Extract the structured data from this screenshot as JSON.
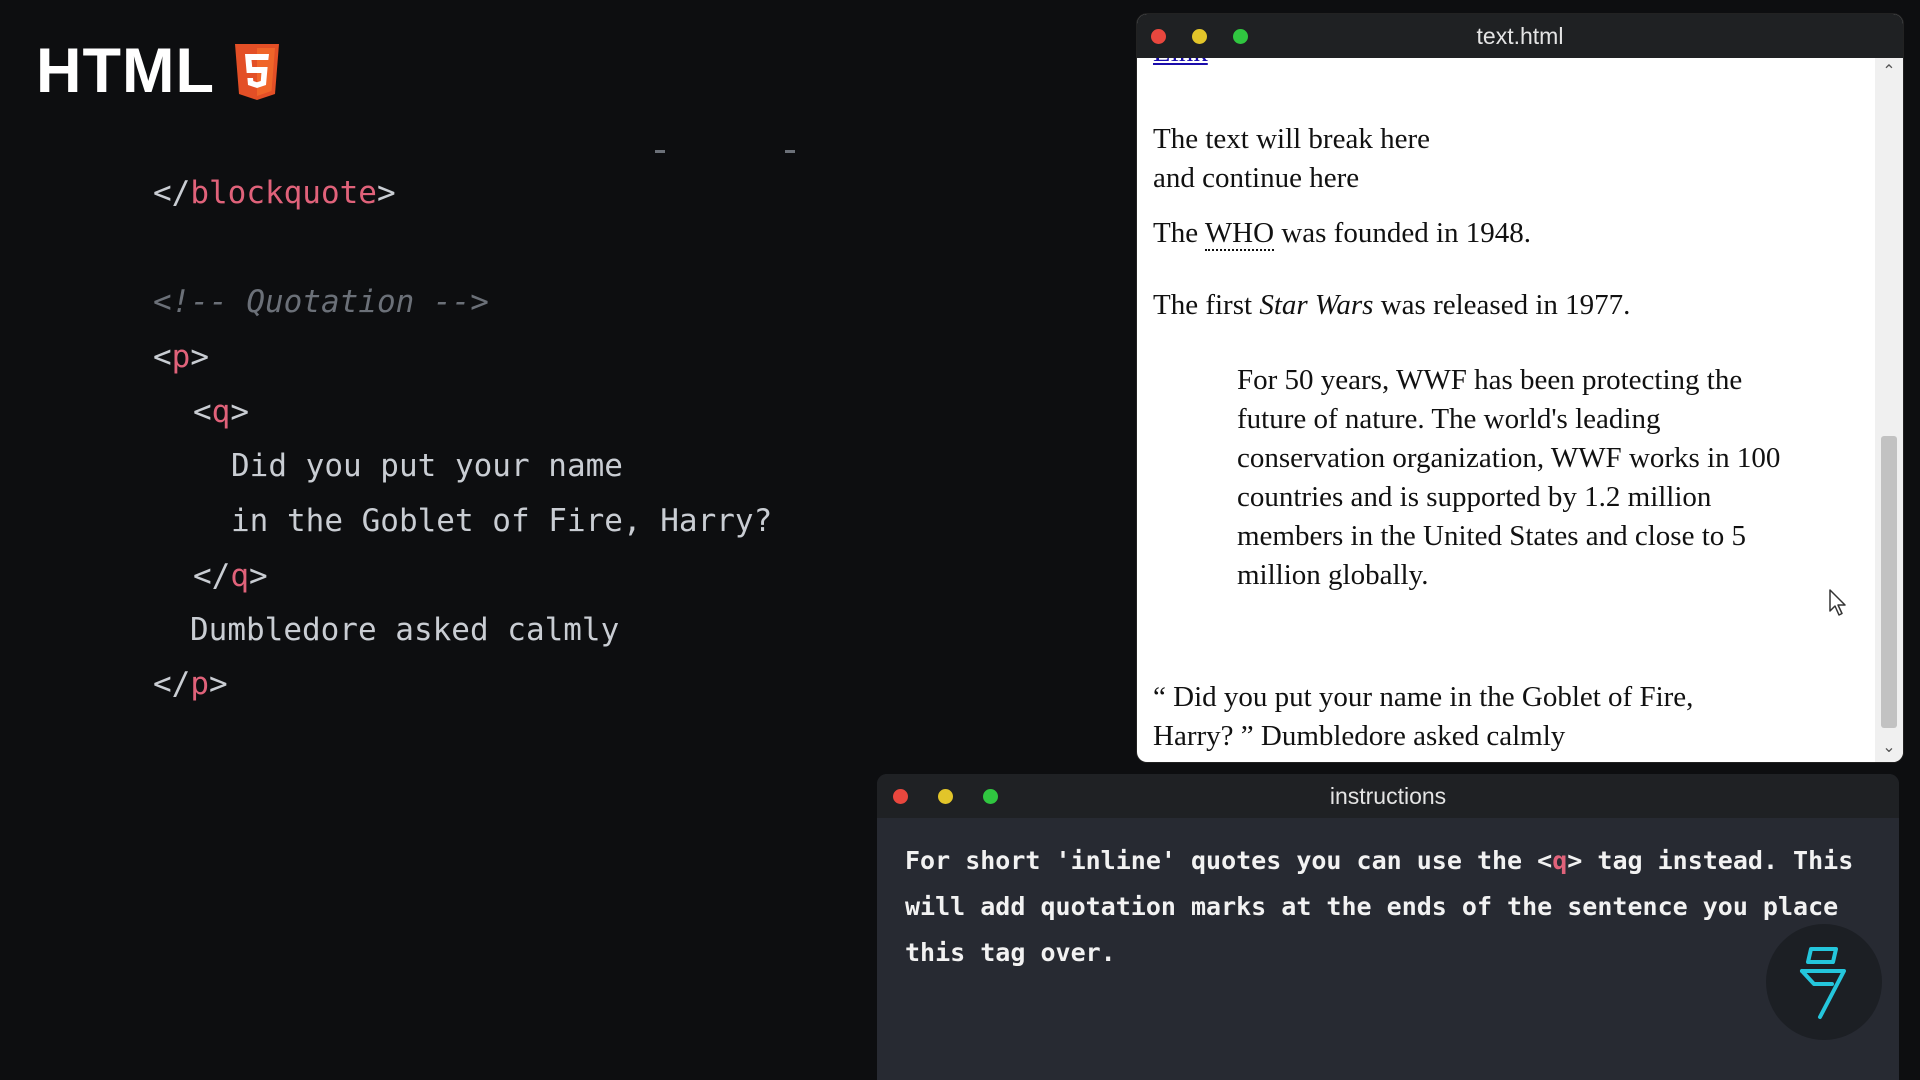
{
  "logo": {
    "text": "HTML",
    "icon": "html5-shield-icon",
    "icon_color": "#e34f26"
  },
  "code": {
    "lines": [
      {
        "kind": "close-tag",
        "open": "</",
        "name": "blockquote",
        "close": ">"
      },
      {
        "kind": "comment",
        "text": "<!-- Quotation -->"
      },
      {
        "kind": "open-tag",
        "open": "<",
        "name": "p",
        "close": ">"
      },
      {
        "kind": "open-tag",
        "open": "<",
        "name": "q",
        "close": ">"
      },
      {
        "kind": "text",
        "text": "Did you put your name"
      },
      {
        "kind": "text",
        "text": "in the Goblet of Fire, Harry?"
      },
      {
        "kind": "close-tag",
        "open": "</",
        "name": "q",
        "close": ">"
      },
      {
        "kind": "text",
        "text": "Dumbledore asked calmly"
      },
      {
        "kind": "close-tag",
        "open": "</",
        "name": "p",
        "close": ">"
      }
    ]
  },
  "browser": {
    "title": "text.html",
    "link_text": "Link",
    "line_break_1": "The text will break here",
    "line_break_2": "and continue here",
    "abbr_before": "The ",
    "abbr_text": "WHO",
    "abbr_after": " was founded in 1948.",
    "cite_before": "The first ",
    "cite_text": "Star Wars",
    "cite_after": " was released in 1977.",
    "blockquote": "For 50 years, WWF has been protecting the future of nature. The world's leading conservation organization, WWF works in 100 countries and is supported by 1.2 million members in the United States and close to 5 million globally.",
    "quote_line_1": "“ Did you put your name in the Goblet of Fire,",
    "quote_line_2": "Harry? ” Dumbledore asked calmly"
  },
  "instructions": {
    "title": "instructions",
    "text_before": "For short 'inline' quotes you can use the ",
    "tag_open": "<",
    "tag_name": "q",
    "tag_close": ">",
    "text_after": " tag instead. This will add quotation marks at the ends of the sentence you place this tag over."
  },
  "colors": {
    "tag": "#e0627a",
    "comment": "#6b7078",
    "code_text": "#c9cdd3",
    "badge_accent": "#24c6dc"
  }
}
